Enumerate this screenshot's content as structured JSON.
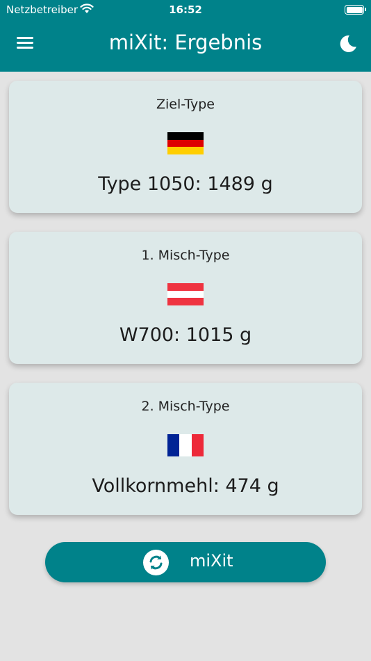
{
  "status_bar": {
    "carrier": "Netzbetreiber",
    "time": "16:52"
  },
  "header": {
    "title": "miXit: Ergebnis"
  },
  "cards": [
    {
      "label": "Ziel-Type",
      "flag": "germany-flag",
      "result": "Type 1050: 1489 g"
    },
    {
      "label": "1. Misch-Type",
      "flag": "austria-flag",
      "result": "W700: 1015 g"
    },
    {
      "label": "2. Misch-Type",
      "flag": "france-flag",
      "result": "Vollkornmehl: 474 g"
    }
  ],
  "action": {
    "label": "miXit",
    "icon": "refresh-icon"
  },
  "colors": {
    "primary": "#00828a",
    "card_bg": "#dde9e9",
    "page_bg": "#e3e3e3"
  }
}
